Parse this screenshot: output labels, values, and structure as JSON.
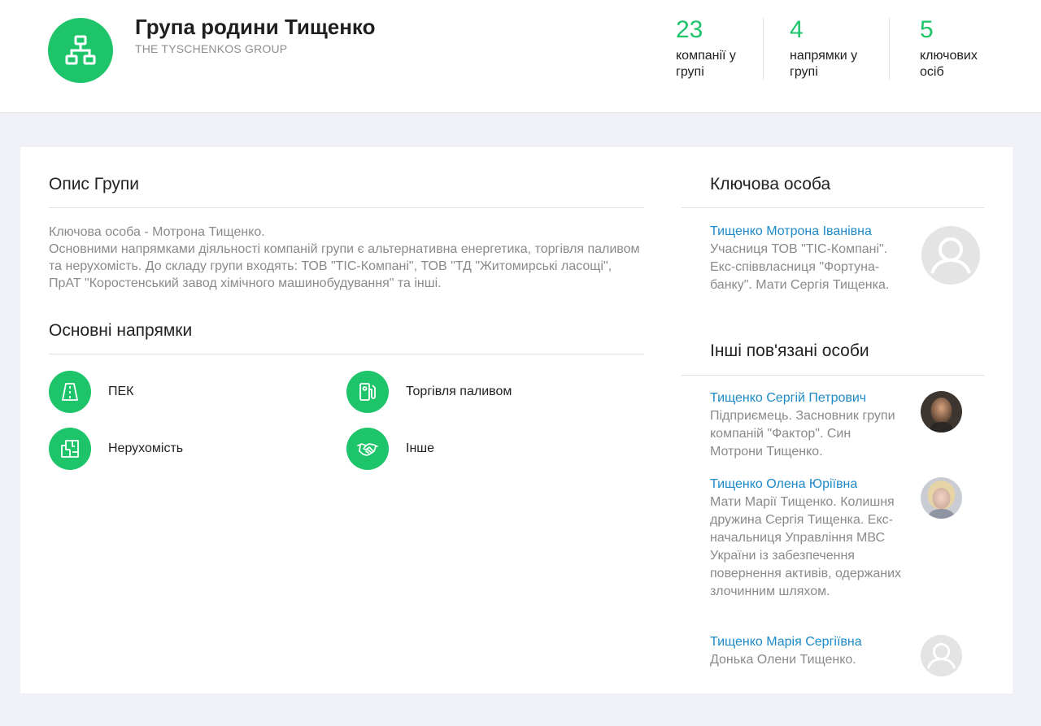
{
  "header": {
    "title": "Група родини Тищенко",
    "subtitle": "THE TYSCHENKOS GROUP",
    "logo_icon": "org-structure-icon",
    "stats": [
      {
        "value": "23",
        "label_line1": "компанії у",
        "label_line2": "групі"
      },
      {
        "value": "4",
        "label_line1": "напрямки у",
        "label_line2": "групі"
      },
      {
        "value": "5",
        "label_line1": "ключових",
        "label_line2": "осіб"
      }
    ]
  },
  "description": {
    "title": "Опис Групи",
    "line1": "Ключова особа - Мотрона Тищенко.",
    "text": "Основними напрямками діяльності компаній групи є альтернативна енергетика, торгівля паливом та нерухомість. До складу групи входять: ТОВ \"ТІС-Компані\", ТОВ \"ТД \"Житомирські ласощі\", ПрАТ \"Коростенський завод хімічного машинобудування\" та інші."
  },
  "directions": {
    "title": "Основні напрямки",
    "items": [
      {
        "label": "ПЕК",
        "icon": "road-icon"
      },
      {
        "label": "Торгівля паливом",
        "icon": "fuel-pump-icon"
      },
      {
        "label": "Нерухомість",
        "icon": "floor-plan-icon"
      },
      {
        "label": "Інше",
        "icon": "handshake-icon"
      }
    ]
  },
  "key_person": {
    "title": "Ключова особа",
    "name": "Тищенко Мотрона Іванівна",
    "desc": "Учасниця ТОВ \"ТІС-Компані\". Екс-співвласниця \"Фортуна-банку\". Мати Сергія Тищенка."
  },
  "other_persons": {
    "title": "Інші пов'язані особи",
    "items": [
      {
        "name": "Тищенко Сергій Петрович",
        "desc": "Підприємець. Засновник групи компаній \"Фактор\". Син Мотрони Тищенко."
      },
      {
        "name": "Тищенко Олена Юріївна",
        "desc": "Мати Марії Тищенко. Колишня дружина Сергія Тищенка. Екс-начальниця Управління МВС України із забезпечення повернення активів, одержаних злочинним шляхом."
      },
      {
        "name": "Тищенко Марія Сергіївна",
        "desc": "Донька Олени Тищенко."
      }
    ]
  },
  "colors": {
    "accent": "#1ec46a",
    "link": "#1c8ac8",
    "muted_text": "#8a8a8a",
    "background": "#eff1f6"
  }
}
